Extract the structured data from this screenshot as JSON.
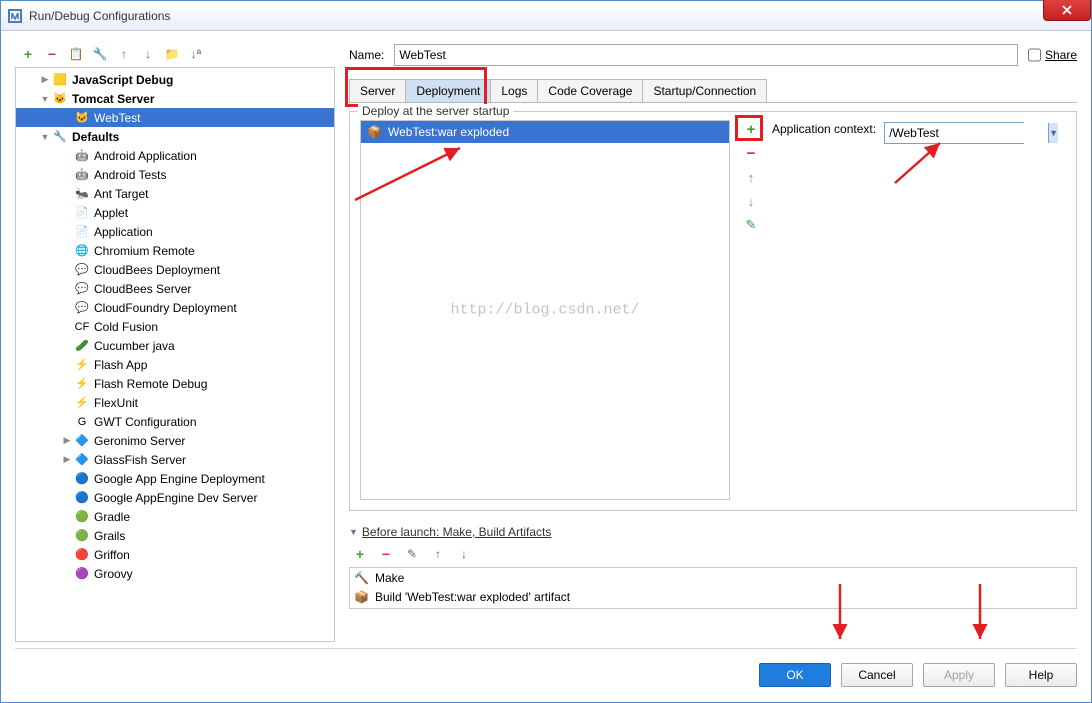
{
  "window": {
    "title": "Run/Debug Configurations"
  },
  "sidebar": {
    "nodes": [
      {
        "label": "JavaScript Debug",
        "depth": 0,
        "expand": "▶",
        "icon": "🟨",
        "bold": true
      },
      {
        "label": "Tomcat Server",
        "depth": 0,
        "expand": "▼",
        "icon": "🐱",
        "bold": true
      },
      {
        "label": "WebTest",
        "depth": 1,
        "expand": "",
        "icon": "🐱",
        "selected": true
      },
      {
        "label": "Defaults",
        "depth": 0,
        "expand": "▼",
        "icon": "🔧",
        "bold": true
      },
      {
        "label": "Android Application",
        "depth": 1,
        "expand": "",
        "icon": "🤖"
      },
      {
        "label": "Android Tests",
        "depth": 1,
        "expand": "",
        "icon": "🤖"
      },
      {
        "label": "Ant Target",
        "depth": 1,
        "expand": "",
        "icon": "🐜"
      },
      {
        "label": "Applet",
        "depth": 1,
        "expand": "",
        "icon": "📄"
      },
      {
        "label": "Application",
        "depth": 1,
        "expand": "",
        "icon": "📄"
      },
      {
        "label": "Chromium Remote",
        "depth": 1,
        "expand": "",
        "icon": "🌐"
      },
      {
        "label": "CloudBees Deployment",
        "depth": 1,
        "expand": "",
        "icon": "💬"
      },
      {
        "label": "CloudBees Server",
        "depth": 1,
        "expand": "",
        "icon": "💬"
      },
      {
        "label": "CloudFoundry Deployment",
        "depth": 1,
        "expand": "",
        "icon": "💬"
      },
      {
        "label": "Cold Fusion",
        "depth": 1,
        "expand": "",
        "icon": "CF"
      },
      {
        "label": "Cucumber java",
        "depth": 1,
        "expand": "",
        "icon": "🥒"
      },
      {
        "label": "Flash App",
        "depth": 1,
        "expand": "",
        "icon": "⚡"
      },
      {
        "label": "Flash Remote Debug",
        "depth": 1,
        "expand": "",
        "icon": "⚡"
      },
      {
        "label": "FlexUnit",
        "depth": 1,
        "expand": "",
        "icon": "⚡"
      },
      {
        "label": "GWT Configuration",
        "depth": 1,
        "expand": "",
        "icon": "G"
      },
      {
        "label": "Geronimo Server",
        "depth": 0,
        "expand": "▶",
        "icon": "🔷",
        "ind": 1
      },
      {
        "label": "GlassFish Server",
        "depth": 0,
        "expand": "▶",
        "icon": "🔷",
        "ind": 1
      },
      {
        "label": "Google App Engine Deployment",
        "depth": 1,
        "expand": "",
        "icon": "🔵"
      },
      {
        "label": "Google AppEngine Dev Server",
        "depth": 1,
        "expand": "",
        "icon": "🔵"
      },
      {
        "label": "Gradle",
        "depth": 1,
        "expand": "",
        "icon": "🟢"
      },
      {
        "label": "Grails",
        "depth": 1,
        "expand": "",
        "icon": "🟢"
      },
      {
        "label": "Griffon",
        "depth": 1,
        "expand": "",
        "icon": "🔴"
      },
      {
        "label": "Groovy",
        "depth": 1,
        "expand": "",
        "icon": "🟣"
      }
    ]
  },
  "name": {
    "label": "Name:",
    "value": "WebTest"
  },
  "share": {
    "label": "Share"
  },
  "tabs": {
    "items": [
      "Server",
      "Deployment",
      "Logs",
      "Code Coverage",
      "Startup/Connection"
    ],
    "active": 1
  },
  "deploy": {
    "legend": "Deploy at the server startup",
    "item": "WebTest:war exploded",
    "context_label": "Application context:",
    "context_value": "/WebTest"
  },
  "watermark": "http://blog.csdn.net/",
  "before": {
    "title": "Before launch: Make, Build Artifacts",
    "items": [
      "Make",
      "Build 'WebTest:war exploded' artifact"
    ]
  },
  "buttons": {
    "ok": "OK",
    "cancel": "Cancel",
    "apply": "Apply",
    "help": "Help"
  }
}
